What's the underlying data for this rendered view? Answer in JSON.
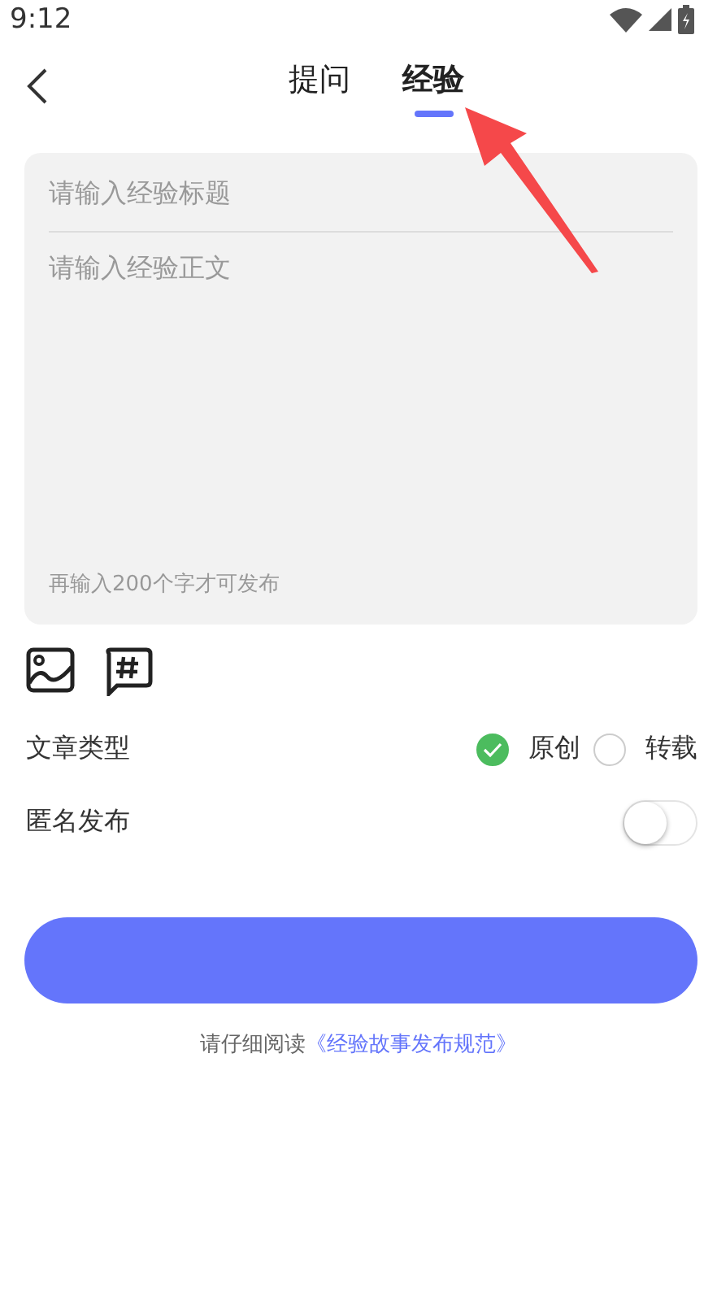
{
  "status_bar": {
    "time": "9:12"
  },
  "tabs": [
    {
      "label": "提问",
      "selected": false
    },
    {
      "label": "经验",
      "selected": true
    }
  ],
  "title_field": {
    "placeholder": "请输入经验标题"
  },
  "body_field": {
    "placeholder": "请输入经验正文"
  },
  "counter": "再输入200个字才可发布",
  "article_type": {
    "label": "文章类型",
    "options": [
      {
        "label": "原创",
        "selected": true
      },
      {
        "label": "转载",
        "selected": false
      }
    ]
  },
  "anonymous": {
    "label": "匿名发布",
    "on": false
  },
  "notice": {
    "text": "请仔细阅读",
    "link": "《经验故事发布规范》"
  }
}
